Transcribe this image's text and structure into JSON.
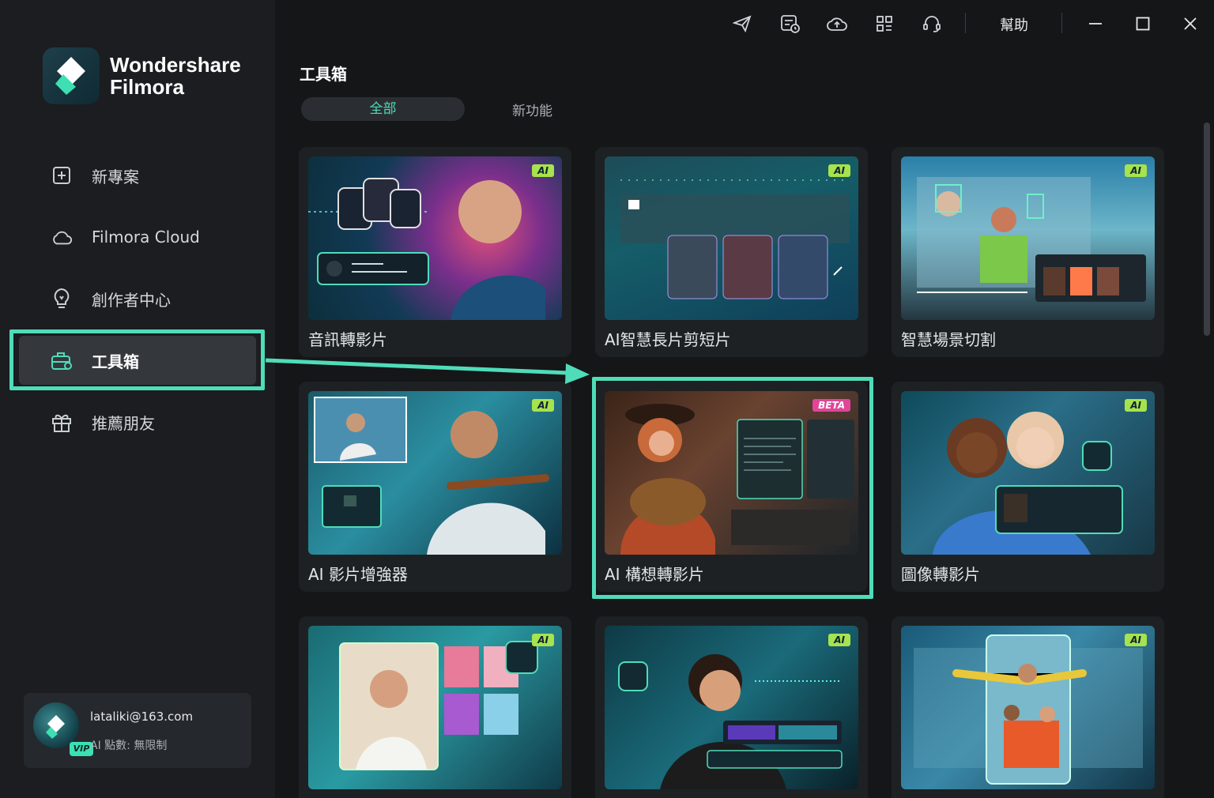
{
  "app": {
    "brand_line1": "Wondershare",
    "brand_line2": "Filmora"
  },
  "sidebar": {
    "items": [
      {
        "label": "新專案",
        "icon": "new-project-icon"
      },
      {
        "label": "Filmora Cloud",
        "icon": "cloud-icon"
      },
      {
        "label": "創作者中心",
        "icon": "lightbulb-icon"
      },
      {
        "label": "工具箱",
        "icon": "toolbox-icon",
        "active": true
      },
      {
        "label": "推薦朋友",
        "icon": "gift-icon"
      }
    ]
  },
  "user": {
    "email": "lataliki@163.com",
    "credits": "AI 點數: 無限制",
    "badge": "VIP"
  },
  "topbar": {
    "help": "幫助",
    "icons": [
      "send-icon",
      "tasks-icon",
      "cloud-upload-icon",
      "grid-icon",
      "headset-icon",
      "minimize-icon",
      "maximize-icon",
      "close-icon"
    ]
  },
  "toolbox": {
    "title": "工具箱",
    "tabs": [
      "全部",
      "新功能"
    ],
    "cards": [
      {
        "label": "音訊轉影片",
        "badge": "AI"
      },
      {
        "label": "AI智慧長片剪短片",
        "badge": "AI"
      },
      {
        "label": "智慧場景切割",
        "badge": "AI"
      },
      {
        "label": "AI 影片增強器",
        "badge": "AI"
      },
      {
        "label": "AI 構想轉影片",
        "badge": "BETA"
      },
      {
        "label": "圖像轉影片",
        "badge": "AI"
      },
      {
        "label": "",
        "badge": "AI"
      },
      {
        "label": "",
        "badge": "AI"
      },
      {
        "label": "",
        "badge": "AI"
      }
    ]
  },
  "colors": {
    "accent": "#4fdcb9",
    "ai_badge": "#a6e34d",
    "beta_badge": "#e0459a"
  }
}
